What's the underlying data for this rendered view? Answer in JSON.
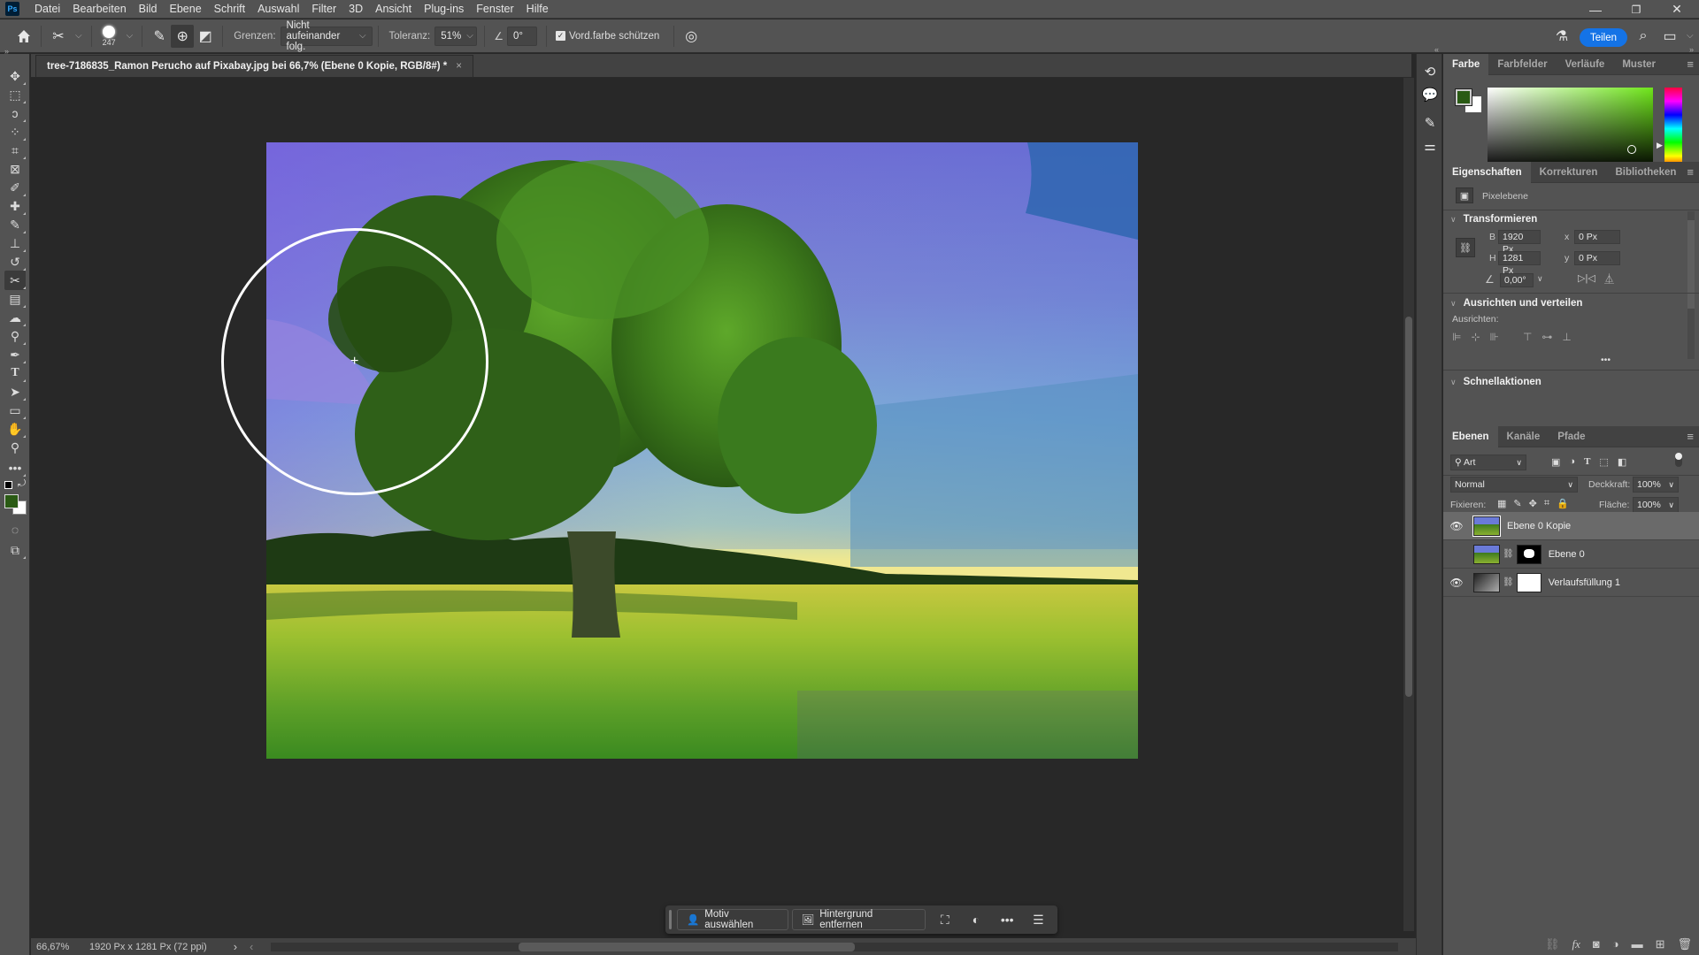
{
  "app": {
    "logo": "Ps",
    "menu": [
      "Datei",
      "Bearbeiten",
      "Bild",
      "Ebene",
      "Schrift",
      "Auswahl",
      "Filter",
      "3D",
      "Ansicht",
      "Plug-ins",
      "Fenster",
      "Hilfe"
    ],
    "window_controls": {
      "minimize": "—",
      "maximize": "❐",
      "close": "✕"
    }
  },
  "options_bar": {
    "brush_size": "247",
    "limits_label": "Grenzen:",
    "limits_value": "Nicht aufeinander folg.",
    "tolerance_label": "Toleranz:",
    "tolerance_value": "51%",
    "angle_value": "0°",
    "protect_fg_label": "Vord.farbe schützen",
    "protect_fg_checked": true,
    "share_label": "Teilen"
  },
  "document": {
    "tab_title": "tree-7186835_Ramon Perucho auf Pixabay.jpg bei 66,7% (Ebene 0 Kopie, RGB/8#) *",
    "close_glyph": "×"
  },
  "status_bar": {
    "zoom": "66,67%",
    "doc_info": "1920 Px x 1281 Px (72 ppi)",
    "arrow": "›",
    "arrow_back": "‹"
  },
  "contextual_task_bar": {
    "select_subject": "Motiv auswählen",
    "remove_background": "Hintergrund entfernen"
  },
  "color_panel": {
    "tabs": [
      "Farbe",
      "Farbfelder",
      "Verläufe",
      "Muster"
    ],
    "active_tab": "Farbe",
    "foreground": "#2a5a14",
    "background": "#ffffff",
    "hue_color": "#6fe61a"
  },
  "properties_panel": {
    "tabs": [
      "Eigenschaften",
      "Korrekturen",
      "Bibliotheken"
    ],
    "active_tab": "Eigenschaften",
    "layer_type": "Pixelebene",
    "transform": {
      "heading": "Transformieren",
      "w_label": "B",
      "w_value": "1920 Px",
      "h_label": "H",
      "h_value": "1281 Px",
      "x_label": "x",
      "x_value": "0 Px",
      "y_label": "y",
      "y_value": "0 Px",
      "angle_value": "0,00°"
    },
    "align": {
      "heading": "Ausrichten und verteilen",
      "sublabel": "Ausrichten:",
      "more": "•••"
    },
    "quick_actions": {
      "heading": "Schnellaktionen"
    }
  },
  "layers_panel": {
    "tabs": [
      "Ebenen",
      "Kanäle",
      "Pfade"
    ],
    "active_tab": "Ebenen",
    "filter_kind": "Art",
    "blend_mode": "Normal",
    "opacity_label": "Deckkraft:",
    "opacity_value": "100%",
    "lock_label": "Fixieren:",
    "fill_label": "Fläche:",
    "fill_value": "100%",
    "layers": [
      {
        "name": "Ebene 0 Kopie",
        "visible": true,
        "selected": true
      },
      {
        "name": "Ebene 0",
        "visible": false,
        "selected": false
      },
      {
        "name": "Verlaufsfüllung 1",
        "visible": true,
        "selected": false
      }
    ]
  }
}
